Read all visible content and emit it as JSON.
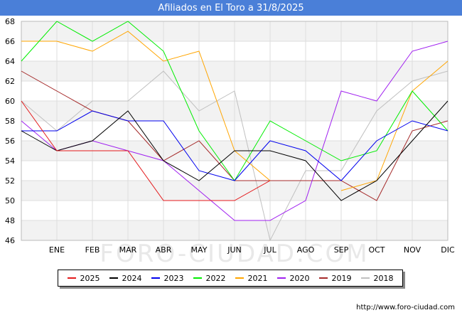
{
  "header": {
    "title": "Afiliados en El Toro a 31/8/2025"
  },
  "footer": {
    "url": "http://www.foro-ciudad.com"
  },
  "watermark": "FORO-CIUDAD.COM",
  "chart_data": {
    "type": "line",
    "title": "Afiliados en El Toro a 31/8/2025",
    "xlabel": "",
    "ylabel": "",
    "categories": [
      "",
      "ENE",
      "FEB",
      "MAR",
      "ABR",
      "MAY",
      "JUN",
      "JUL",
      "AGO",
      "SEP",
      "OCT",
      "NOV",
      "DIC"
    ],
    "ylim": [
      46,
      68
    ],
    "yticks": [
      46,
      48,
      50,
      52,
      54,
      56,
      58,
      60,
      62,
      64,
      66,
      68
    ],
    "grid": true,
    "legend_position": "bottom",
    "series": [
      {
        "name": "2025",
        "color": "#e41a1c",
        "values": [
          60,
          55,
          55,
          55,
          50,
          50,
          50,
          52
        ]
      },
      {
        "name": "2024",
        "color": "#000000",
        "values": [
          57,
          55,
          56,
          59,
          54,
          52,
          55,
          55,
          54,
          50,
          52,
          56,
          60
        ]
      },
      {
        "name": "2023",
        "color": "#0000ee",
        "values": [
          57,
          57,
          59,
          58,
          58,
          53,
          52,
          56,
          55,
          52,
          56,
          58,
          57
        ]
      },
      {
        "name": "2022",
        "color": "#00ee00",
        "values": [
          64,
          68,
          66,
          68,
          65,
          57,
          52,
          58,
          56,
          54,
          55,
          61,
          57
        ]
      },
      {
        "name": "2021",
        "color": "#ffa500",
        "values": [
          66,
          66,
          65,
          67,
          64,
          65,
          55,
          52,
          null,
          51,
          52,
          61,
          64
        ]
      },
      {
        "name": "2020",
        "color": "#a020f0",
        "values": [
          58,
          55,
          56,
          55,
          54,
          51,
          48,
          48,
          50,
          61,
          60,
          65,
          66
        ]
      },
      {
        "name": "2019",
        "color": "#a52a2a",
        "values": [
          63,
          61,
          59,
          58,
          54,
          56,
          52,
          52,
          52,
          52,
          50,
          57,
          58
        ]
      },
      {
        "name": "2018",
        "color": "#c0c0c0",
        "values": [
          60,
          57,
          60,
          60,
          63,
          59,
          61,
          46,
          53,
          53,
          59,
          62,
          63
        ]
      }
    ]
  }
}
